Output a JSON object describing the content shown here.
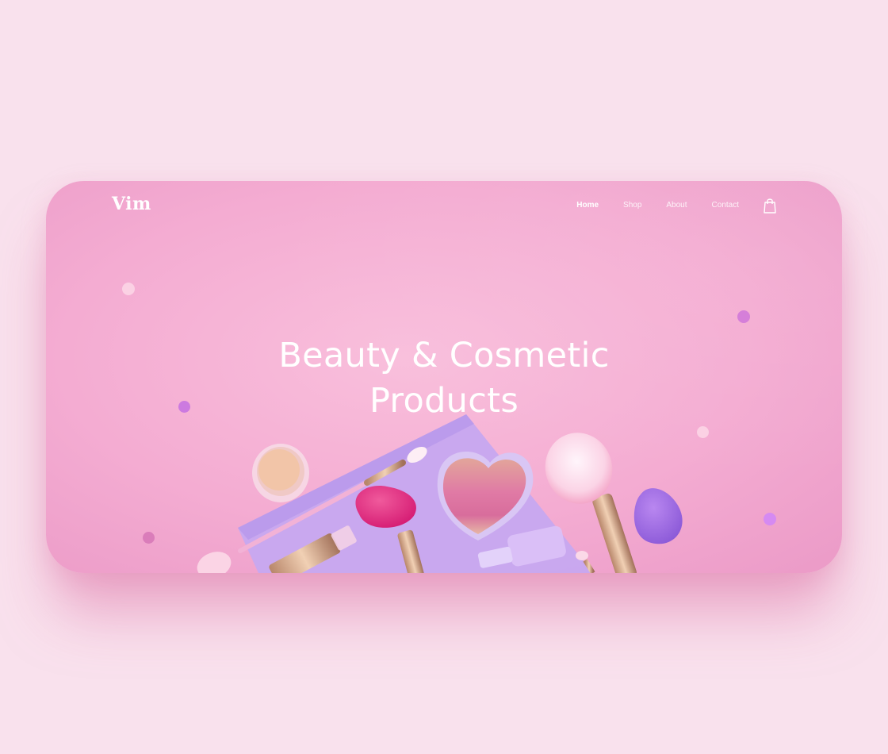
{
  "brand": {
    "logo": "Vim"
  },
  "nav": {
    "items": [
      {
        "label": "Home",
        "active": true
      },
      {
        "label": "Shop",
        "active": false
      },
      {
        "label": "About",
        "active": false
      },
      {
        "label": "Contact",
        "active": false
      }
    ],
    "cart_icon": "shopping-bag-icon"
  },
  "hero": {
    "title_line1": "Beauty & Cosmetic",
    "title_line2": "Products"
  },
  "colors": {
    "page_background": "#f9e1ed",
    "card_pink": "#f4acd2",
    "accent_purple": "#c98ae8",
    "accent_magenta": "#e0248a",
    "paper_lavender": "#c6a8f0",
    "text": "#ffffff"
  }
}
